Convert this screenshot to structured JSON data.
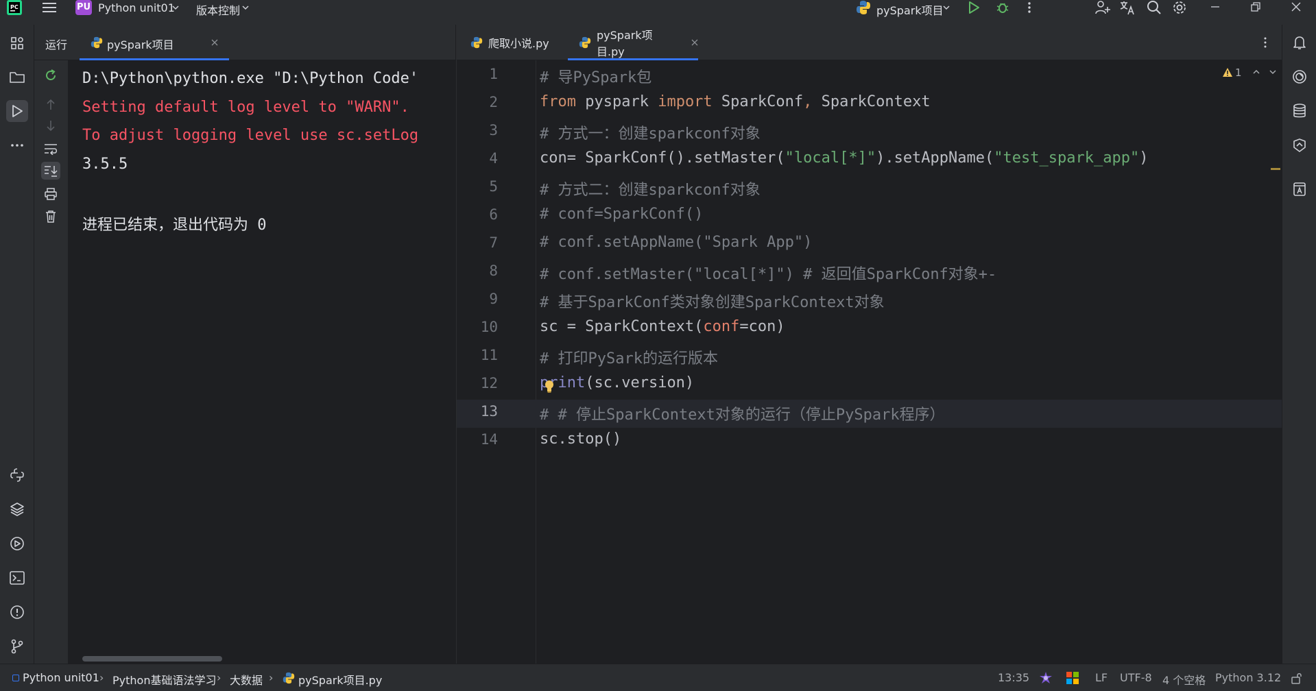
{
  "titlebar": {
    "project_badge": "PU",
    "project_name": "Python unit01",
    "vcs_menu": "版本控制",
    "run_config": "pySpark项目"
  },
  "run_panel": {
    "title": "运行",
    "tab_label": "pySpark项目"
  },
  "console": {
    "lines": [
      "D:\\Python\\python.exe \"D:\\Python Code'",
      "Setting default log level to \"WARN\".",
      "To adjust logging level use sc.setLog",
      "3.5.5",
      "",
      "进程已结束，退出代码为 0"
    ]
  },
  "editor": {
    "tabs": [
      {
        "label": "爬取小说.py"
      },
      {
        "label": "pySpark项目.py"
      }
    ],
    "warning_count": "1",
    "line_numbers": [
      "1",
      "2",
      "3",
      "4",
      "5",
      "6",
      "7",
      "8",
      "9",
      "10",
      "11",
      "12",
      "13",
      "14"
    ],
    "current_line": "13",
    "code": {
      "l1": "# 导PySpark包",
      "l2_from": "from",
      "l2_mod": " pyspark ",
      "l2_import": "import",
      "l2_rest": " SparkConf",
      "l2_comma": ",",
      "l2_rest2": " SparkContext",
      "l3": "# 方式一：创建sparkconf对象",
      "l4_a": "con= SparkConf().setMaster(",
      "l4_s1": "\"local[*]\"",
      "l4_b": ").setAppName(",
      "l4_s2": "\"test_spark_app\"",
      "l4_c": ")",
      "l5": "# 方式二：创建sparkconf对象",
      "l6": "# conf=SparkConf()",
      "l7": "# conf.setAppName(\"Spark App\")",
      "l8": "# conf.setMaster(\"local[*]\") # 返回值SparkConf对象+-",
      "l9": "# 基于SparkConf类对象创建SparkContext对象",
      "l10_a": "sc = SparkContext(",
      "l10_p": "conf",
      "l10_b": "=con)",
      "l11": "# 打印PySark的运行版本",
      "l12_a": "print",
      "l12_b": "(sc.version)",
      "l13": "# # 停止SparkContext对象的运行（停止PySpark程序）",
      "l14": "sc.stop()"
    }
  },
  "breadcrumb": {
    "items": [
      "Python unit01",
      "Python基础语法学习",
      "大数据",
      "pySpark项目.py"
    ]
  },
  "status": {
    "position": "13:35",
    "line_sep": "LF",
    "encoding": "UTF-8",
    "indent": "4 个空格",
    "interpreter": "Python 3.12"
  },
  "colors": {
    "accent": "#3574f0",
    "console_error": "#f75464",
    "keyword": "#cf8e6d",
    "string": "#6aab73"
  }
}
